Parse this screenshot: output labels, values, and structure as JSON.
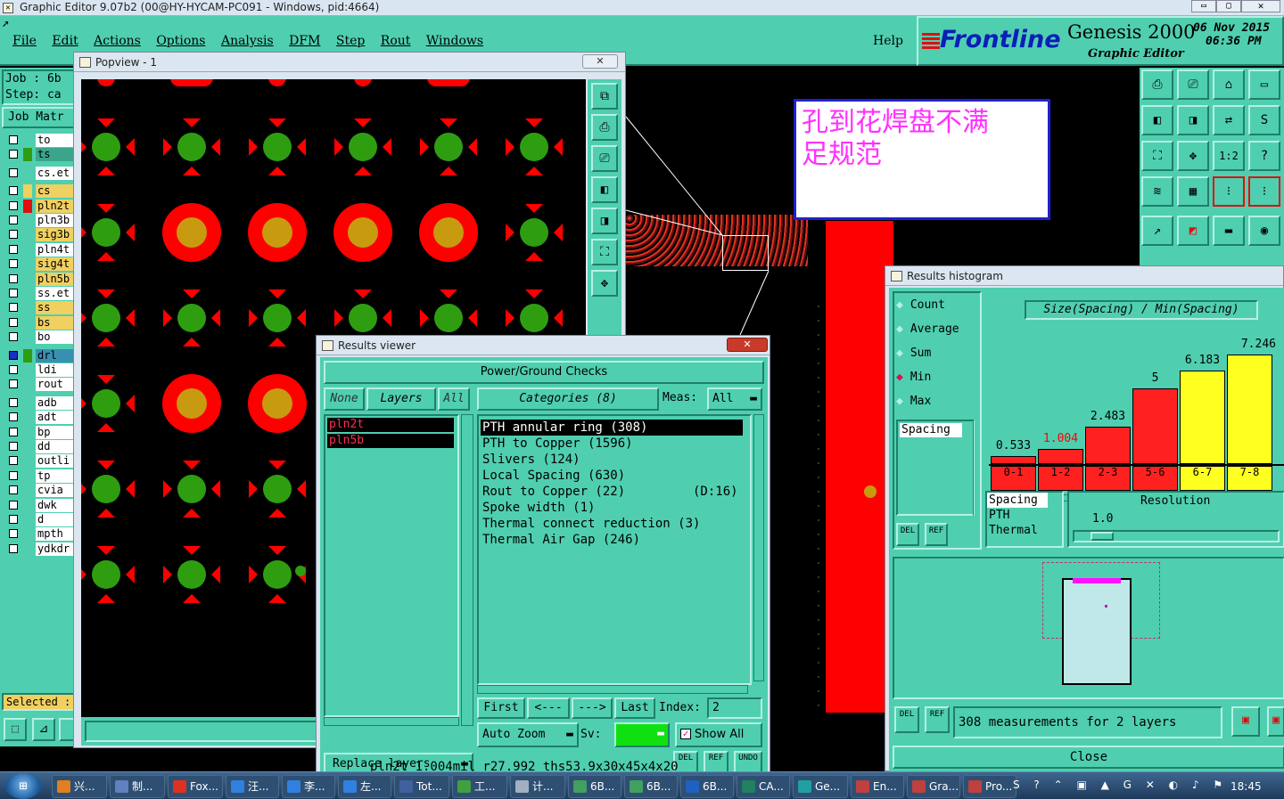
{
  "app": {
    "title": "Graphic Editor 9.07b2 (00@HY-HYCAM-PC091 - Windows, pid:4664)"
  },
  "menu": [
    "File",
    "Edit",
    "Actions",
    "Options",
    "Analysis",
    "DFM",
    "Step",
    "Rout",
    "Windows"
  ],
  "help": "Help",
  "brand": {
    "logo": "Frontline",
    "product": "Genesis 2000",
    "subtitle": "Graphic Editor",
    "date": "06 Nov 2015",
    "time": "06:36 PM"
  },
  "left_panel": {
    "job": "Job : 6b",
    "step": "Step: ca",
    "job_matrix": "Job Matr",
    "layers": [
      "to",
      "ts",
      "cs.et",
      "cs",
      "pln2t",
      "pln3b",
      "sig3b",
      "pln4t",
      "sig4t",
      "pln5b",
      "ss.et",
      "ss",
      "bs",
      "bo",
      "drl",
      "ldi",
      "rout",
      "adb",
      "adt",
      "bp",
      "dd",
      "outli",
      "tp",
      "cvia",
      "dwk",
      "d",
      "mpth",
      "ydkdr"
    ],
    "selected": "Selected :"
  },
  "popview": {
    "title": "Popview - 1"
  },
  "annotation": {
    "line1": "孔到花焊盘不满",
    "line2": "足规范"
  },
  "results_viewer": {
    "title": "Results viewer",
    "header": "Power/Ground Checks",
    "tab_none": "None",
    "tab_layers": "Layers",
    "tab_all": "All",
    "categories_label": "Categories (8)",
    "meas_label": "Meas:",
    "meas_value": "All",
    "layers": [
      "pln2t",
      "pln5b"
    ],
    "categories": [
      "PTH annular ring (308)",
      "PTH to Copper (1596)",
      "Slivers (124)",
      "Local Spacing (630)",
      "Rout to Copper (22)",
      "Spoke width (1)",
      "Thermal connect reduction (3)",
      "Thermal Air Gap (246)"
    ],
    "rout_extra": "(D:16)",
    "btn_first": "First",
    "btn_prev": "<---",
    "btn_next": "--->",
    "btn_last": "Last",
    "index_label": "Index:",
    "index_value": "2",
    "auto_zoom": "Auto Zoom",
    "sv_label": "Sv:",
    "show_all": "Show All",
    "replace_layers": "Replace layers",
    "del": "DEL",
    "ref": "REF",
    "undo": "UNDO",
    "status": "pln2t 1.004mil r27.992 ths53.9x30x45x4x20"
  },
  "histogram": {
    "title": "Results histogram",
    "options": [
      "Count",
      "Average",
      "Sum",
      "Min",
      "Max"
    ],
    "selected_option": "Min",
    "header": "Size(Spacing) / Min(Spacing)",
    "spacing_item": "Spacing",
    "resolution_label": "Resolution",
    "resolution_value": "1.0",
    "list2": [
      "Spacing",
      "PTH",
      "Thermal"
    ],
    "measurements": "308 measurements for 2 layers",
    "close": "Close",
    "del": "DEL",
    "ref": "REF"
  },
  "chart_data": {
    "type": "bar",
    "title": "Size(Spacing) / Min(Spacing)",
    "categories": [
      "0-1",
      "1-2",
      "2-3",
      "5-6",
      "6-7",
      "7-8"
    ],
    "values": [
      0.533,
      1.004,
      2.483,
      5,
      6.183,
      7.246
    ],
    "value_labels": [
      "0.533",
      "1.004",
      "2.483",
      "5",
      "6.183",
      "7.246"
    ],
    "colors": [
      "#ff2020",
      "#ff2020",
      "#ff2020",
      "#ff2020",
      "#ffff20",
      "#ffff20"
    ],
    "label_colors": [
      "#000000",
      "#ff0000",
      "#000000",
      "#000000",
      "#000000",
      "#000000"
    ],
    "ylim": [
      0,
      8
    ]
  },
  "taskbar": {
    "items": [
      "兴...",
      "制...",
      "Fox...",
      "汪...",
      "李...",
      "左...",
      "Tot...",
      "工...",
      "计...",
      "6B...",
      "6B...",
      "6B...",
      "CA...",
      "Ge...",
      "En...",
      "Gra...",
      "Pro..."
    ],
    "clock": "18:45"
  },
  "colors": {
    "panel": "#4fcfb0",
    "canvas": "#000000",
    "pad_red": "#ff0000",
    "pad_green": "#2e9e10",
    "pad_core": "#c89a10"
  }
}
